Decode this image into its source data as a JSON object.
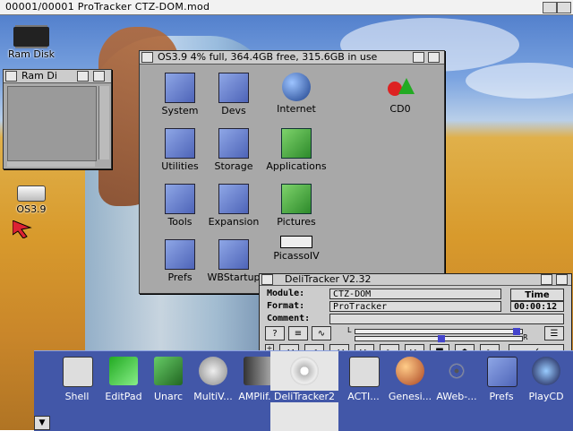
{
  "screen_title": "00001/00001 ProTracker CTZ-DOM.mod",
  "desktop_icons": [
    {
      "label": "Ram Disk"
    },
    {
      "label": "OS3.9"
    }
  ],
  "ramdisk_window": {
    "title": "Ram Di"
  },
  "os39_window": {
    "title": "OS3.9  4% full, 364.4GB free, 315.6GB in use",
    "icons": [
      {
        "label": "System"
      },
      {
        "label": "Devs"
      },
      {
        "label": "Internet"
      },
      {
        "label": "CD0"
      },
      {
        "label": "Utilities"
      },
      {
        "label": "Storage"
      },
      {
        "label": "Applications"
      },
      {
        "label": "Tools"
      },
      {
        "label": "Expansion"
      },
      {
        "label": "Pictures"
      },
      {
        "label": "Prefs"
      },
      {
        "label": "WBStartup"
      },
      {
        "label": "PicassoIV"
      }
    ]
  },
  "delitracker": {
    "title": "DeliTracker V2.32",
    "module_label": "Module:",
    "module_value": "CTZ-DOM",
    "format_label": "Format:",
    "format_value": "ProTracker",
    "comment_label": "Comment:",
    "comment_value": "",
    "time_label": "Time",
    "time_value": "00:00:12",
    "help_btn": "?",
    "slider_left": "L",
    "slider_right": "R",
    "controls": [
      "◂◂",
      "◂",
      "◂◂",
      "▸▸",
      "▸",
      "▸▸",
      "■",
      "⏏",
      "▸"
    ]
  },
  "dock": [
    {
      "label": "Shell"
    },
    {
      "label": "EditPad"
    },
    {
      "label": "Unarc"
    },
    {
      "label": "MultiV..."
    },
    {
      "label": "AMPlif..."
    },
    {
      "label": "DeliTracker2"
    },
    {
      "label": "ACTI..."
    },
    {
      "label": "Genesi..."
    },
    {
      "label": "AWeb-..."
    },
    {
      "label": "Prefs"
    },
    {
      "label": "PlayCD"
    }
  ]
}
